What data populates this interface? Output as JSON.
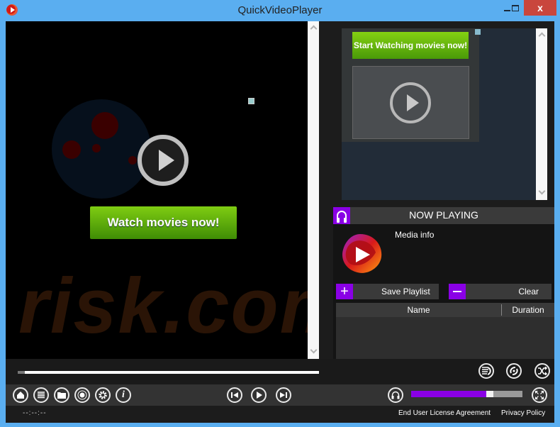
{
  "window": {
    "title": "QuickVideoPlayer",
    "close_label": "x"
  },
  "video": {
    "ad_button_label": "Watch movies now!",
    "watermark_text": "risk.com"
  },
  "ad": {
    "button_label": "Start Watching movies now!"
  },
  "now_playing": {
    "title": "NOW PLAYING",
    "media_info": "Media info",
    "save_playlist_label": "Save Playlist",
    "save_playlist_icon": "+",
    "clear_label": "Clear",
    "columns": [
      {
        "label": "Name"
      },
      {
        "label": "Duration"
      }
    ],
    "rows": []
  },
  "playback": {
    "time": "--:--:--",
    "seek_progress_percent": 0,
    "volume_percent": 72
  },
  "toolbar": {
    "left_icons": [
      "home-icon",
      "playlist-icon",
      "folder-icon",
      "record-icon",
      "settings-icon",
      "info-icon"
    ],
    "info_glyph": "i"
  },
  "footer": {
    "eula_label": "End User License Agreement",
    "privacy_label": "Privacy Policy"
  },
  "colors": {
    "accent": "#8a00e6",
    "titlebar": "#5aaef0",
    "close": "#c9463d",
    "ad_green": "#5fae0a"
  }
}
